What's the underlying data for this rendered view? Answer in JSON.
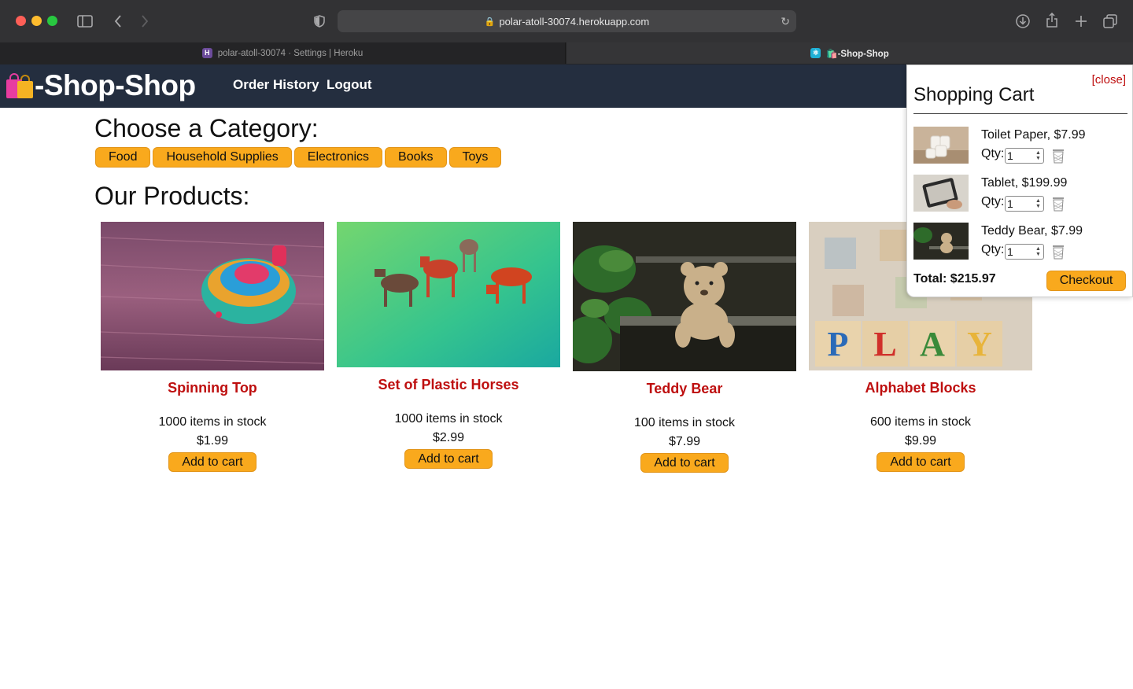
{
  "browser": {
    "url": "polar-atoll-30074.herokuapp.com",
    "tabs": [
      {
        "label": "polar-atoll-30074 · Settings | Heroku",
        "active": false
      },
      {
        "label": "🛍️-Shop-Shop",
        "active": true
      }
    ]
  },
  "header": {
    "brand": "-Shop-Shop",
    "nav": [
      "Order History",
      "Logout"
    ]
  },
  "categories": {
    "title": "Choose a Category:",
    "items": [
      "Food",
      "Household Supplies",
      "Electronics",
      "Books",
      "Toys"
    ]
  },
  "products": {
    "title": "Our Products:",
    "add_label": "Add to cart",
    "items": [
      {
        "name": "Spinning Top",
        "stock": "1000 items in stock",
        "price": "$1.99"
      },
      {
        "name": "Set of Plastic Horses",
        "stock": "1000 items in stock",
        "price": "$2.99"
      },
      {
        "name": "Teddy Bear",
        "stock": "100 items in stock",
        "price": "$7.99"
      },
      {
        "name": "Alphabet Blocks",
        "stock": "600 items in stock",
        "price": "$9.99"
      }
    ]
  },
  "cart": {
    "close": "[close]",
    "title": "Shopping Cart",
    "qty_label": "Qty:",
    "items": [
      {
        "label": "Toilet Paper, $7.99",
        "qty": "1"
      },
      {
        "label": "Tablet, $199.99",
        "qty": "1"
      },
      {
        "label": "Teddy Bear, $7.99",
        "qty": "1"
      }
    ],
    "total": "Total: $215.97",
    "checkout": "Checkout"
  },
  "colors": {
    "accent": "#f9a91d",
    "header_bg": "#242e3f",
    "product_name": "#be0f0f"
  }
}
